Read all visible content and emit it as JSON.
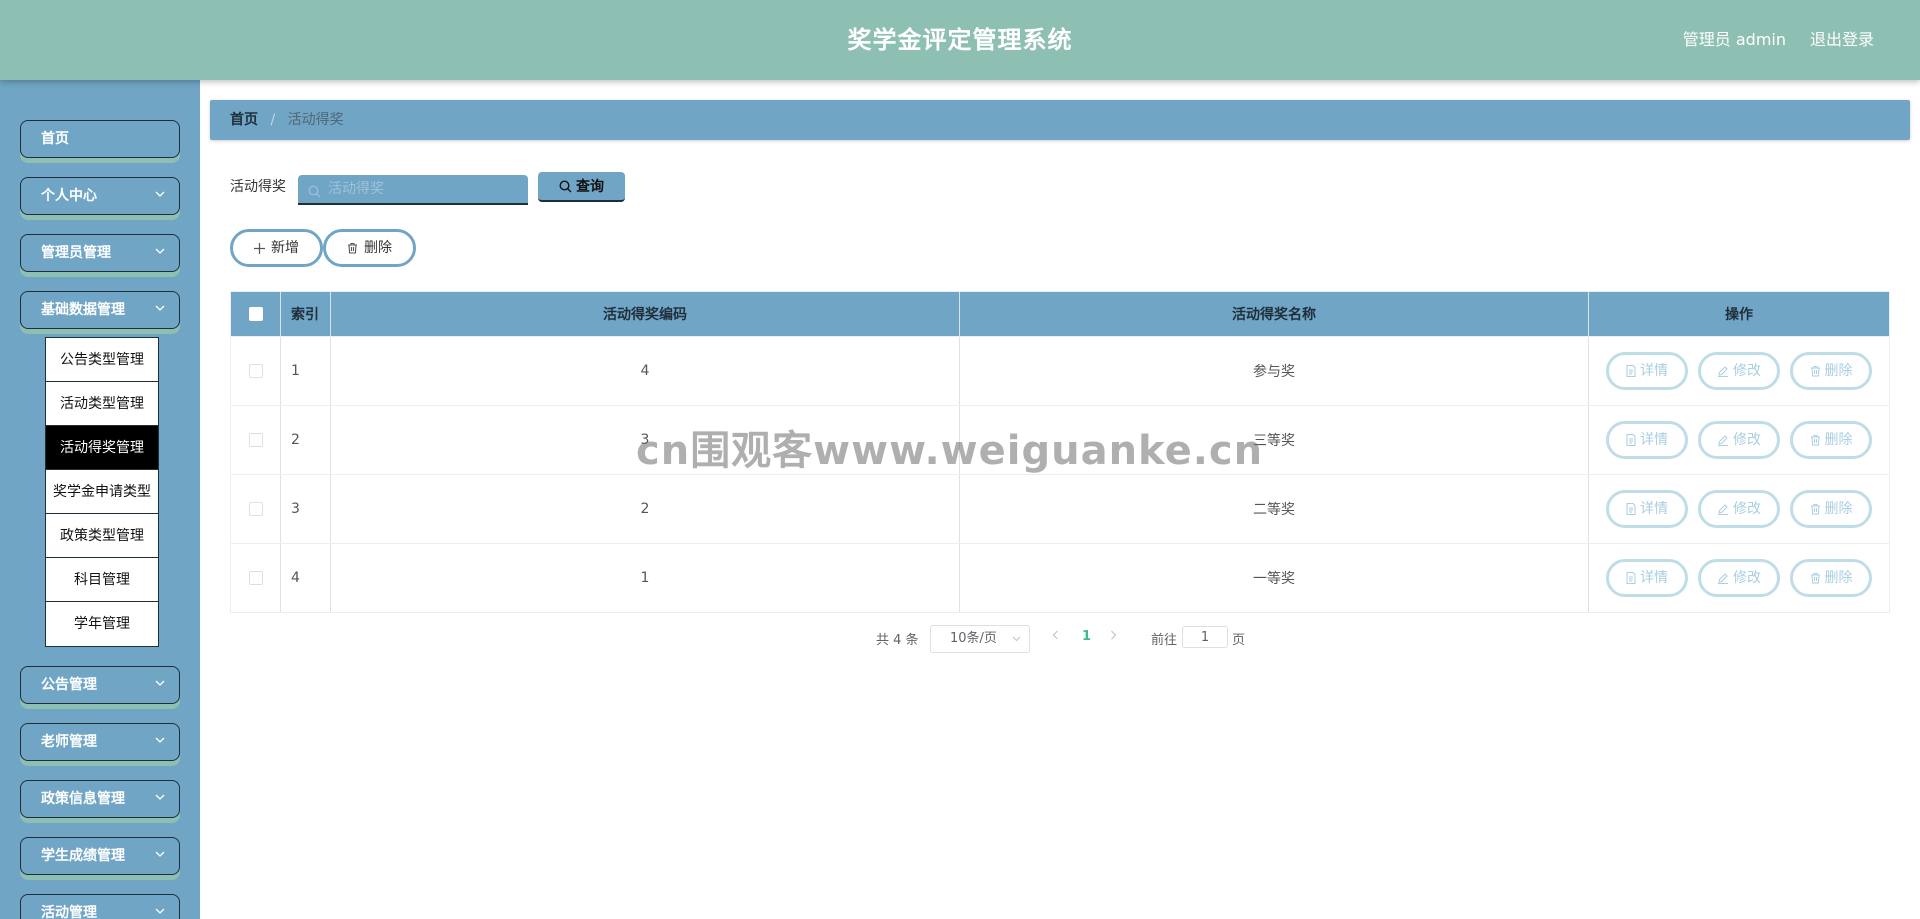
{
  "header": {
    "title": "奖学金评定管理系统",
    "user": "管理员 admin",
    "logout": "退出登录"
  },
  "sidebar": {
    "items": [
      {
        "label": "首页",
        "has_chevron": false
      },
      {
        "label": "个人中心",
        "has_chevron": true
      },
      {
        "label": "管理员管理",
        "has_chevron": true
      },
      {
        "label": "基础数据管理",
        "has_chevron": true
      },
      {
        "label": "公告管理",
        "has_chevron": true
      },
      {
        "label": "老师管理",
        "has_chevron": true
      },
      {
        "label": "政策信息管理",
        "has_chevron": true
      },
      {
        "label": "学生成绩管理",
        "has_chevron": true
      },
      {
        "label": "活动管理",
        "has_chevron": true
      }
    ],
    "submenu": [
      {
        "label": "公告类型管理",
        "active": false
      },
      {
        "label": "活动类型管理",
        "active": false
      },
      {
        "label": "活动得奖管理",
        "active": true
      },
      {
        "label": "奖学金申请类型",
        "active": false
      },
      {
        "label": "政策类型管理",
        "active": false
      },
      {
        "label": "科目管理",
        "active": false
      },
      {
        "label": "学年管理",
        "active": false
      }
    ]
  },
  "breadcrumb": {
    "home": "首页",
    "separator": "/",
    "current": "活动得奖"
  },
  "search": {
    "label": "活动得奖",
    "placeholder": "活动得奖",
    "button": "查询"
  },
  "actions": {
    "add": "新增",
    "delete": "删除"
  },
  "table": {
    "headers": {
      "index": "索引",
      "code": "活动得奖编码",
      "name": "活动得奖名称",
      "ops": "操作"
    },
    "rows": [
      {
        "index": "1",
        "code": "4",
        "name": "参与奖"
      },
      {
        "index": "2",
        "code": "3",
        "name": "三等奖"
      },
      {
        "index": "3",
        "code": "2",
        "name": "二等奖"
      },
      {
        "index": "4",
        "code": "1",
        "name": "一等奖"
      }
    ],
    "row_actions": {
      "detail": "详情",
      "edit": "修改",
      "delete": "删除"
    }
  },
  "pagination": {
    "total": "共 4 条",
    "page_size": "10条/页",
    "current_page": "1",
    "goto_label": "前往",
    "goto_value": "1",
    "goto_unit": "页"
  },
  "watermark": "cn围观客www.weiguanke.cn",
  "colors": {
    "header_bg": "#8dbfb2",
    "sidebar_bg": "#70a5c6",
    "accent": "#70a5c6",
    "active_submenu": "#000000",
    "current_page": "#3fb98f"
  }
}
